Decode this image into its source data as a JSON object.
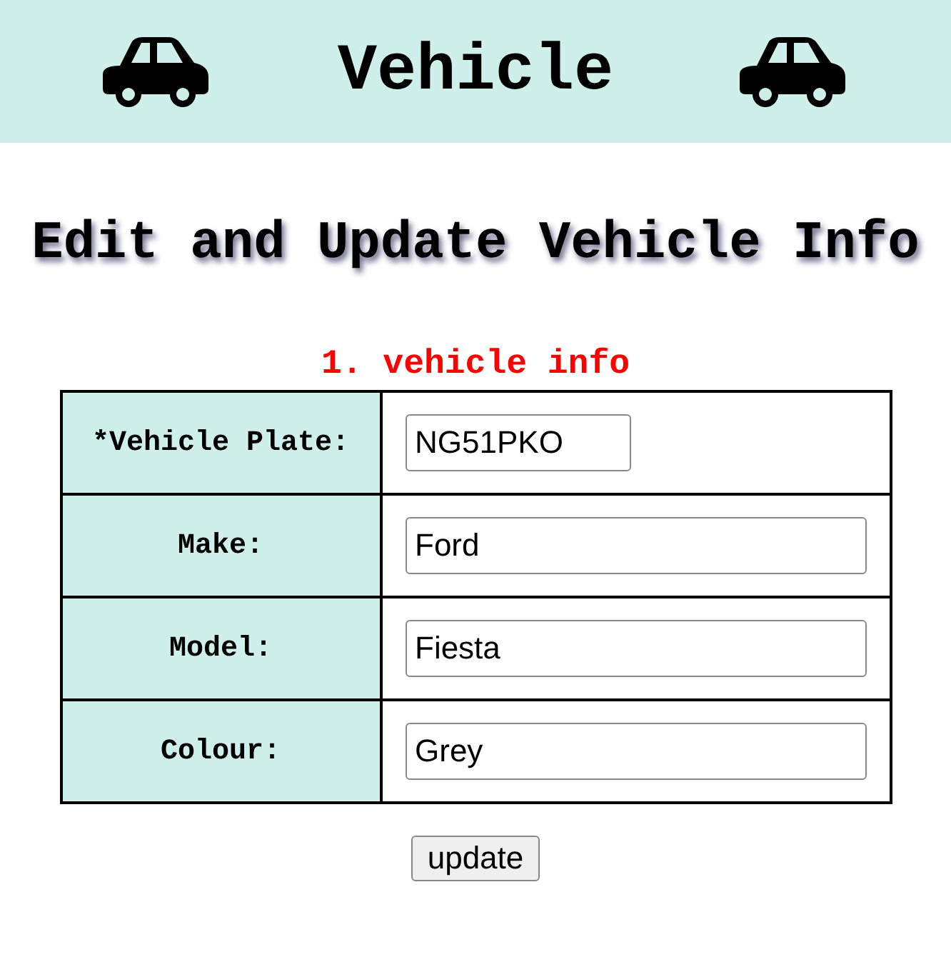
{
  "header": {
    "title": "Vehicle"
  },
  "heading": "Edit and Update Vehicle Info",
  "section": {
    "title": "1. vehicle info",
    "fields": [
      {
        "label": "*Vehicle Plate:",
        "value": "NG51PKO",
        "kind": "short"
      },
      {
        "label": "Make:",
        "value": "Ford",
        "kind": "full"
      },
      {
        "label": "Model:",
        "value": "Fiesta",
        "kind": "full"
      },
      {
        "label": "Colour:",
        "value": "Grey",
        "kind": "full"
      }
    ]
  },
  "buttons": [
    "update"
  ]
}
